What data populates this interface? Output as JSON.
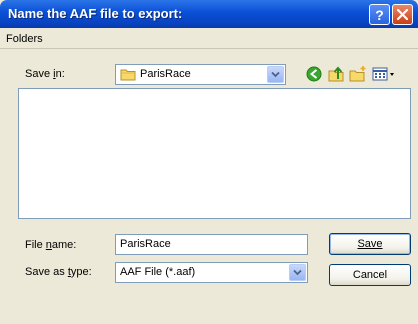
{
  "window": {
    "title": "Name the AAF file to export:"
  },
  "subheader": {
    "label": "Folders"
  },
  "save_in": {
    "label": "Save in:",
    "value": "ParisRace"
  },
  "toolbar": {
    "icons": [
      "back-icon",
      "up-folder-icon",
      "new-folder-icon",
      "view-menu-icon"
    ]
  },
  "file_name": {
    "label": "File name:",
    "value": "ParisRace"
  },
  "save_as_type": {
    "label": "Save as type:",
    "value": "AAF File (*.aaf)"
  },
  "buttons": {
    "save": "Save",
    "cancel": "Cancel"
  },
  "colors": {
    "title_bar": "#0a4fd6",
    "dialog_bg": "#ece9d8",
    "input_border": "#7f9db9",
    "close_button": "#cc3e15"
  }
}
